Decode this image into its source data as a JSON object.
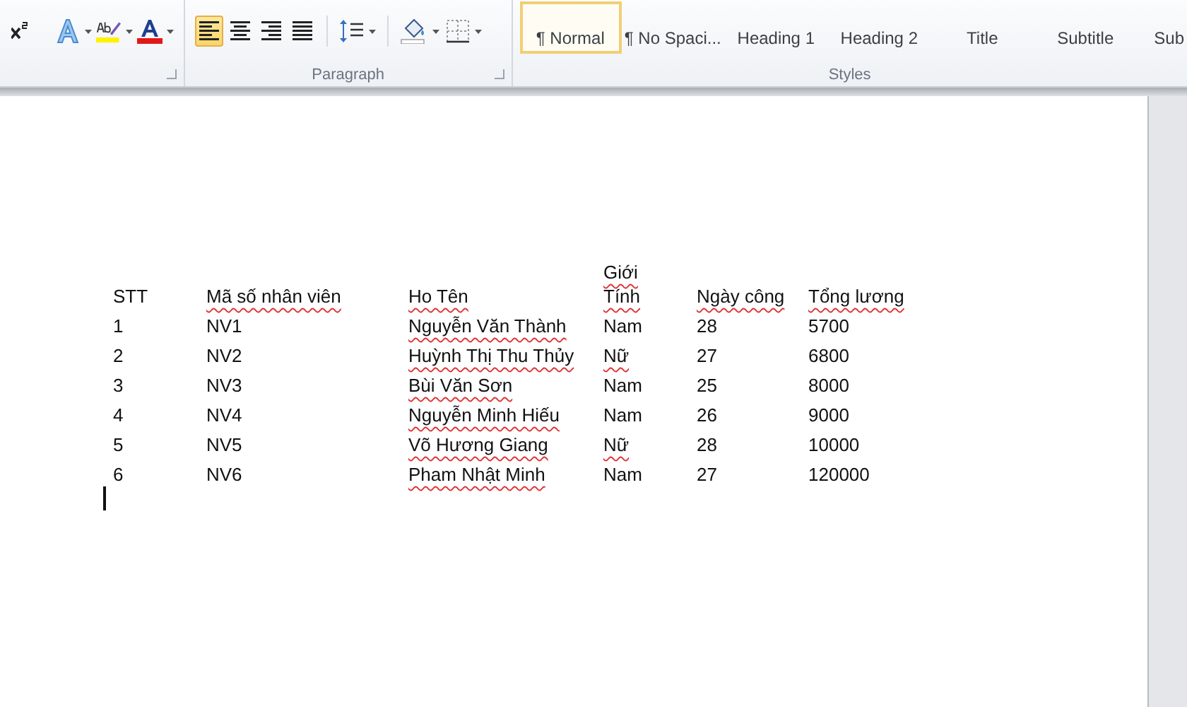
{
  "ribbon": {
    "font_group": {
      "tools": [
        {
          "kind": "superscript"
        },
        {
          "kind": "text-effects"
        },
        {
          "kind": "highlight"
        },
        {
          "kind": "font-color"
        }
      ]
    },
    "paragraph_group": {
      "label": "Paragraph",
      "tools": [
        {
          "kind": "align-left",
          "selected": true
        },
        {
          "kind": "align-center",
          "selected": false
        },
        {
          "kind": "align-right",
          "selected": false
        },
        {
          "kind": "justify",
          "selected": false
        },
        {
          "kind": "line-spacing",
          "selected": false
        },
        {
          "kind": "shading",
          "selected": false
        },
        {
          "kind": "borders",
          "selected": false
        }
      ]
    },
    "styles_group": {
      "label": "Styles",
      "styles": [
        {
          "label": "¶ Normal",
          "selected": true
        },
        {
          "label": "¶ No Spaci...",
          "selected": false
        },
        {
          "label": "Heading 1",
          "selected": false
        },
        {
          "label": "Heading 2",
          "selected": false
        },
        {
          "label": "Title",
          "selected": false
        },
        {
          "label": "Subtitle",
          "selected": false
        },
        {
          "label": "Sub",
          "selected": false
        }
      ]
    }
  },
  "document": {
    "table": {
      "columns": [
        {
          "text": "STT",
          "misspelled": false
        },
        {
          "text": "Mã số nhân viên",
          "misspelled": true
        },
        {
          "text": "Ho Tên",
          "misspelled": true
        },
        {
          "text": "Giới\nTính",
          "misspelled": true
        },
        {
          "text": "Ngày công",
          "misspelled": true
        },
        {
          "text": "Tổng lương",
          "misspelled": true
        }
      ],
      "rows": [
        [
          {
            "text": "1",
            "misspelled": false
          },
          {
            "text": "NV1",
            "misspelled": false
          },
          {
            "text": "Nguyễn Văn Thành",
            "misspelled": true
          },
          {
            "text": "Nam",
            "misspelled": false
          },
          {
            "text": "28",
            "misspelled": false
          },
          {
            "text": "5700",
            "misspelled": false
          }
        ],
        [
          {
            "text": "2",
            "misspelled": false
          },
          {
            "text": "NV2",
            "misspelled": false
          },
          {
            "text": "Huỳnh Thị Thu Thủy",
            "misspelled": true
          },
          {
            "text": "Nữ",
            "misspelled": true
          },
          {
            "text": "27",
            "misspelled": false
          },
          {
            "text": "6800",
            "misspelled": false
          }
        ],
        [
          {
            "text": "3",
            "misspelled": false
          },
          {
            "text": "NV3",
            "misspelled": false
          },
          {
            "text": "Bùi Văn Sơn",
            "misspelled": true
          },
          {
            "text": "Nam",
            "misspelled": false
          },
          {
            "text": "25",
            "misspelled": false
          },
          {
            "text": "8000",
            "misspelled": false
          }
        ],
        [
          {
            "text": "4",
            "misspelled": false
          },
          {
            "text": "NV4",
            "misspelled": false
          },
          {
            "text": "Nguyễn Minh Hiếu",
            "misspelled": true
          },
          {
            "text": "Nam",
            "misspelled": false
          },
          {
            "text": "26",
            "misspelled": false
          },
          {
            "text": "9000",
            "misspelled": false
          }
        ],
        [
          {
            "text": "5",
            "misspelled": false
          },
          {
            "text": "NV5",
            "misspelled": false
          },
          {
            "text": "Võ Hương Giang",
            "misspelled": true
          },
          {
            "text": "Nữ",
            "misspelled": true
          },
          {
            "text": "28",
            "misspelled": false
          },
          {
            "text": "10000",
            "misspelled": false
          }
        ],
        [
          {
            "text": "6",
            "misspelled": false
          },
          {
            "text": "NV6",
            "misspelled": false
          },
          {
            "text": "Pham Nhật Minh",
            "misspelled": true
          },
          {
            "text": "Nam",
            "misspelled": false
          },
          {
            "text": "27",
            "misspelled": false
          },
          {
            "text": "120000",
            "misspelled": false
          }
        ]
      ]
    }
  }
}
